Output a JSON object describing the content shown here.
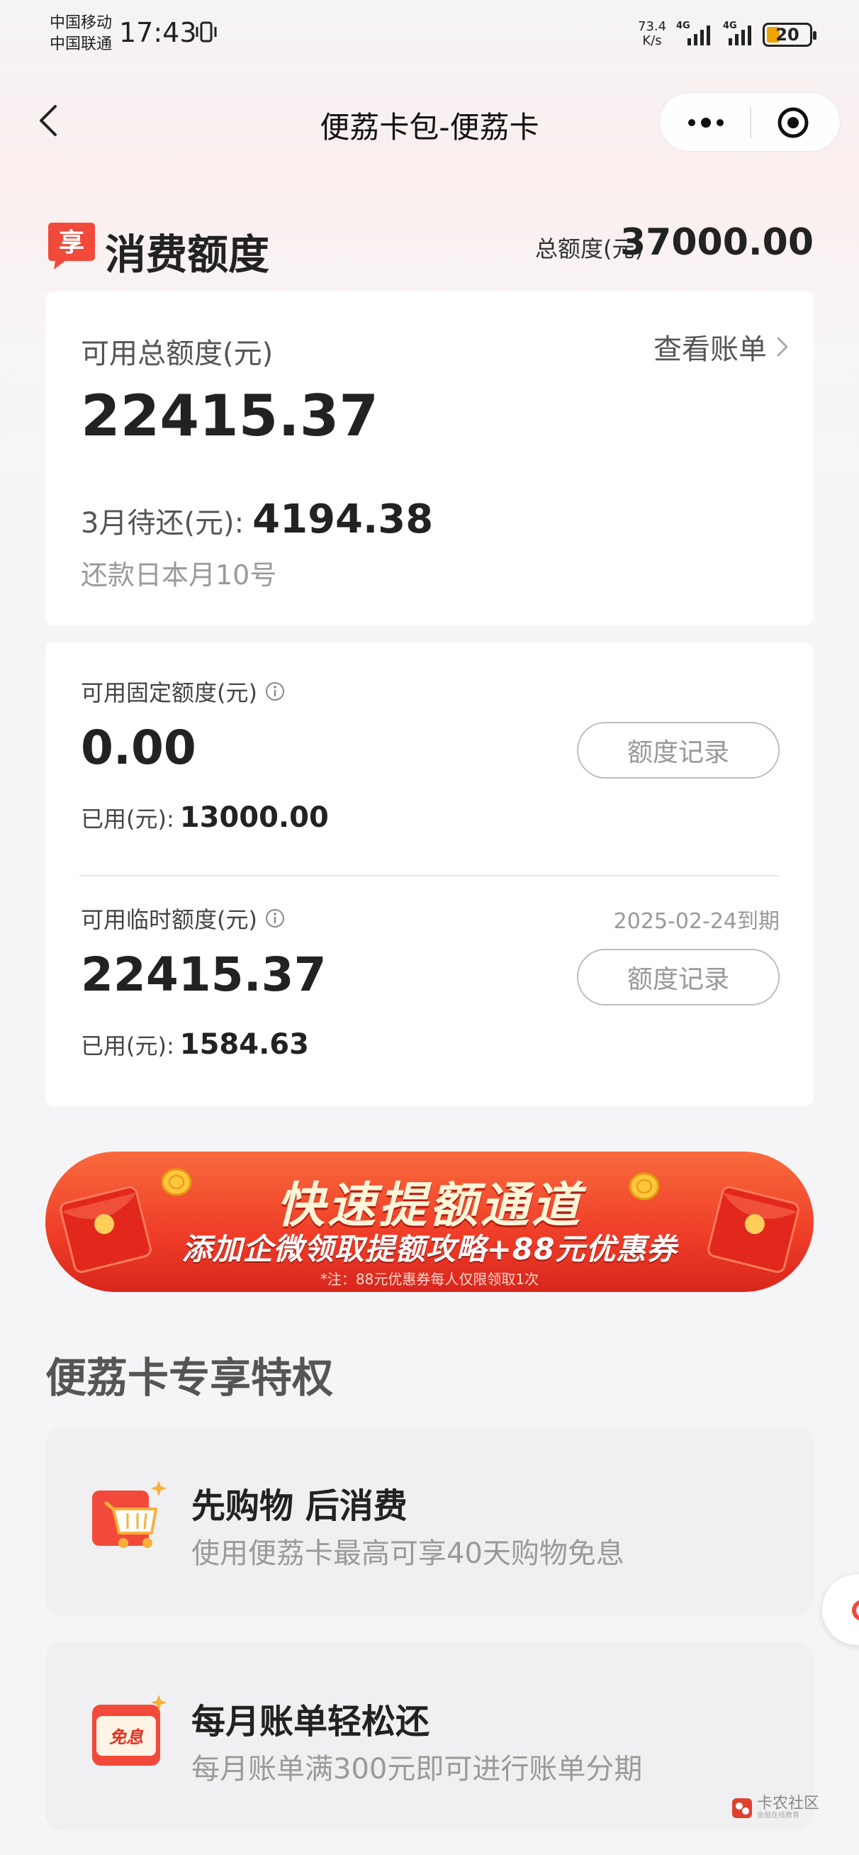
{
  "status_bar": {
    "carrier1": "中国移动",
    "carrier2": "中国联通",
    "time": "17:43",
    "net_speed_value": "73.4",
    "net_speed_unit": "K/s",
    "net1": "4G",
    "net2": "4G",
    "battery": "20"
  },
  "nav": {
    "title": "便荔卡包-便荔卡"
  },
  "quota": {
    "title": "消费额度",
    "badge_char": "享",
    "total_label": "总额度(元)",
    "total_value": "37000.00"
  },
  "summary": {
    "available_label": "可用总额度(元)",
    "bill_link": "查看账单",
    "available_amount": "22415.37",
    "due_label": "3月待还(元):",
    "due_amount": "4194.38",
    "repay_day": "还款日本月10号"
  },
  "fixed": {
    "label": "可用固定额度(元)",
    "amount": "0.00",
    "used_label": "已用(元):",
    "used_amount": "13000.00",
    "record_button": "额度记录"
  },
  "temp": {
    "label": "可用临时额度(元)",
    "expire": "2025-02-24到期",
    "amount": "22415.37",
    "used_label": "已用(元):",
    "used_amount": "1584.63",
    "record_button": "额度记录"
  },
  "banner": {
    "title": "快速提额通道",
    "subtitle": "添加企微领取提额攻略+88元优惠券",
    "note": "*注：88元优惠券每人仅限领取1次"
  },
  "privileges": {
    "title": "便荔卡专享特权",
    "items": [
      {
        "title": "先购物 后消费",
        "desc": "使用便荔卡最高可享40天购物免息",
        "icon": "shopping-cart-icon"
      },
      {
        "title": "每月账单轻松还",
        "desc": "每月账单满300元即可进行账单分期",
        "icon": "interest-free-icon",
        "icon_text": "免息"
      }
    ]
  },
  "watermark": {
    "text": "卡农社区",
    "sub": "金融在线教育"
  },
  "colors": {
    "accent_red": "#f24a3a",
    "banner_red": "#ef3d28",
    "battery": "#f0a400"
  }
}
